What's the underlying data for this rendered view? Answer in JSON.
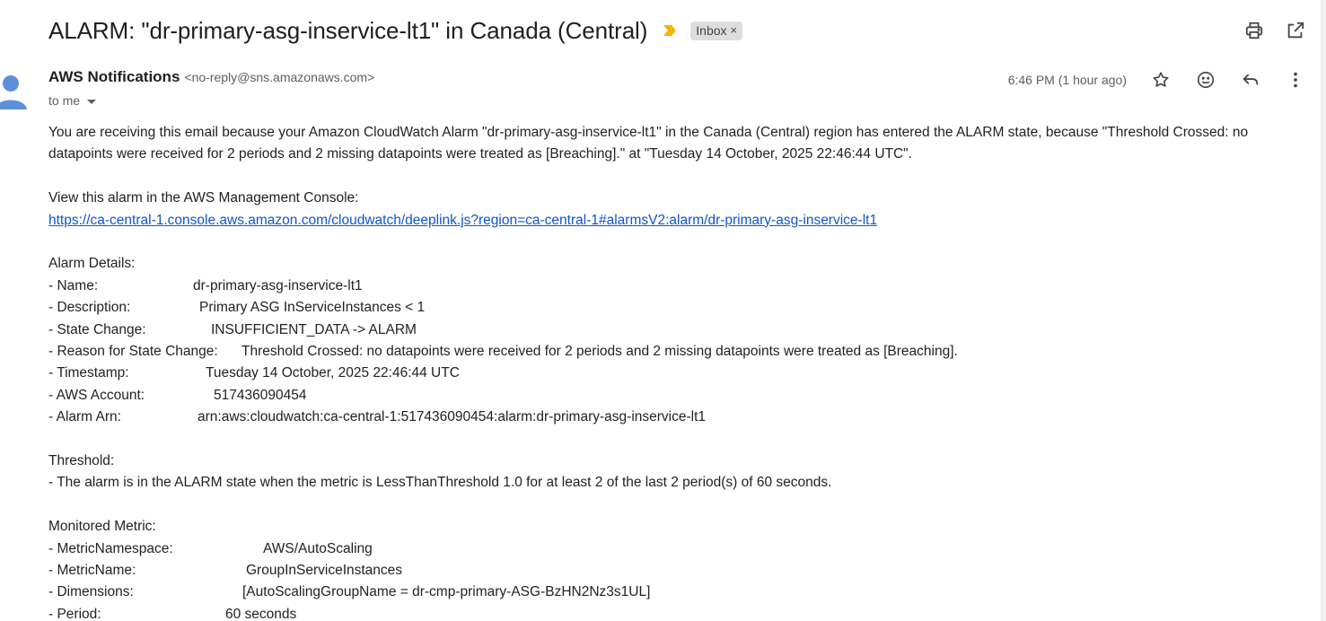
{
  "subject": "ALARM: \"dr-primary-asg-inservice-lt1\" in Canada (Central)",
  "label_chip": "Inbox",
  "label_chip_close": "×",
  "colors": {
    "importance": "#f4b400",
    "link": "#1155cc",
    "chip_bg": "#dddddd",
    "avatar": "#5f8fd9"
  },
  "sender": {
    "name": "AWS Notifications",
    "email": "<no-reply@sns.amazonaws.com>",
    "recipient": "to me"
  },
  "timestamp": "6:46 PM (1 hour ago)",
  "icons": {
    "top": [
      "print-icon",
      "open-in-new-window-icon"
    ],
    "message": [
      "star-icon",
      "emoji-reaction-icon",
      "reply-icon",
      "more-options-icon"
    ]
  },
  "body": {
    "intro": "You are receiving this email because your Amazon CloudWatch Alarm \"dr-primary-asg-inservice-lt1\" in the Canada (Central) region has entered the ALARM state, because \"Threshold Crossed: no datapoints were received for 2 periods and 2 missing datapoints were treated as [Breaching].\" at \"Tuesday 14 October, 2025 22:46:44 UTC\".",
    "console_label": "View this alarm in the AWS Management Console:",
    "console_link": "https://ca-central-1.console.aws.amazon.com/cloudwatch/deeplink.js?region=ca-central-1#alarmsV2:alarm/dr-primary-asg-inservice-lt1",
    "alarm_details_heading": "Alarm Details:",
    "alarm_details": [
      {
        "key": "- Name:",
        "value": "dr-primary-asg-inservice-lt1"
      },
      {
        "key": "- Description:",
        "value": "Primary ASG InServiceInstances < 1"
      },
      {
        "key": "- State Change:",
        "value": "INSUFFICIENT_DATA -> ALARM"
      },
      {
        "key": "- Reason for State Change:",
        "value": "Threshold Crossed: no datapoints were received for 2 periods and 2 missing datapoints were treated as [Breaching]."
      },
      {
        "key": "- Timestamp:",
        "value": "Tuesday 14 October, 2025 22:46:44 UTC"
      },
      {
        "key": "- AWS Account:",
        "value": "517436090454"
      },
      {
        "key": "- Alarm Arn:",
        "value": "arn:aws:cloudwatch:ca-central-1:517436090454:alarm:dr-primary-asg-inservice-lt1"
      }
    ],
    "threshold_heading": "Threshold:",
    "threshold_text": "- The alarm is in the ALARM state when the metric is LessThanThreshold 1.0 for at least 2 of the last 2 period(s) of 60 seconds.",
    "metric_heading": "Monitored Metric:",
    "metric_details": [
      {
        "key": "- MetricNamespace:",
        "value": "AWS/AutoScaling"
      },
      {
        "key": "- MetricName:",
        "value": "GroupInServiceInstances"
      },
      {
        "key": "- Dimensions:",
        "value": "[AutoScalingGroupName = dr-cmp-primary-ASG-BzHN2Nz3s1UL]"
      },
      {
        "key": "- Period:",
        "value": "60 seconds"
      }
    ]
  }
}
